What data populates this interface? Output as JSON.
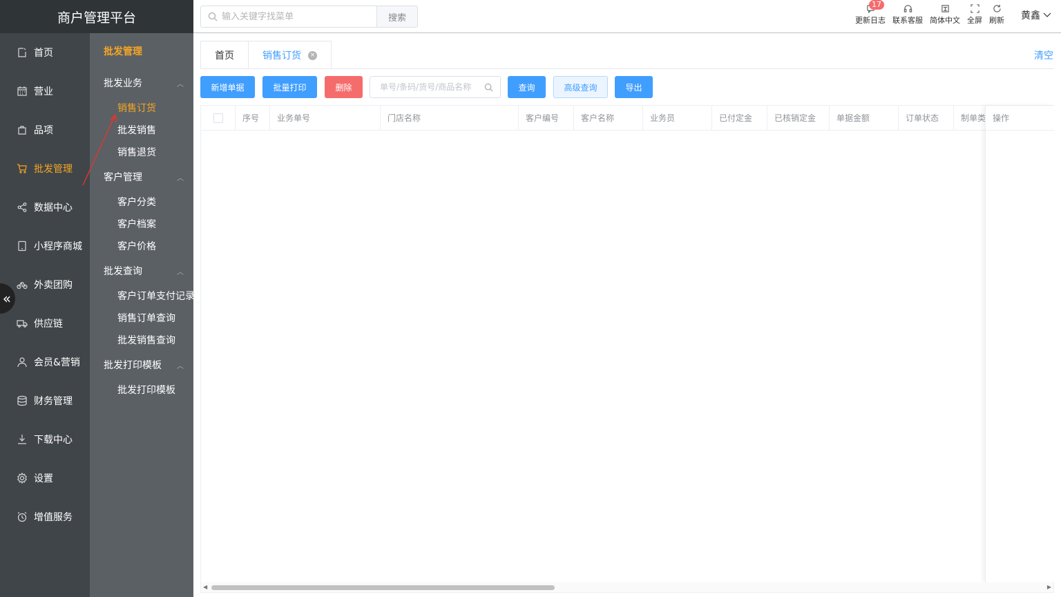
{
  "app": {
    "title": "商户管理平台"
  },
  "primary_nav": [
    {
      "label": "首页",
      "icon": "home-icon",
      "active": false
    },
    {
      "label": "营业",
      "icon": "calendar-icon",
      "active": false
    },
    {
      "label": "品项",
      "icon": "bag-icon",
      "active": false
    },
    {
      "label": "批发管理",
      "icon": "cart-icon",
      "active": true
    },
    {
      "label": "数据中心",
      "icon": "share-icon",
      "active": false
    },
    {
      "label": "小程序商城",
      "icon": "tablet-icon",
      "active": false
    },
    {
      "label": "外卖团购",
      "icon": "bike-icon",
      "active": false
    },
    {
      "label": "供应链",
      "icon": "truck-icon",
      "active": false
    },
    {
      "label": "会员&营销",
      "icon": "user-icon",
      "active": false
    },
    {
      "label": "财务管理",
      "icon": "database-icon",
      "active": false
    },
    {
      "label": "下载中心",
      "icon": "download-icon",
      "active": false
    },
    {
      "label": "设置",
      "icon": "gear-icon",
      "active": false
    },
    {
      "label": "增值服务",
      "icon": "clock-icon",
      "active": false
    }
  ],
  "secondary_nav": {
    "title": "批发管理",
    "groups": [
      {
        "label": "批发业务",
        "items": [
          "销售订货",
          "批发销售",
          "销售退货"
        ]
      },
      {
        "label": "客户管理",
        "items": [
          "客户分类",
          "客户档案",
          "客户价格"
        ]
      },
      {
        "label": "批发查询",
        "items": [
          "客户订单支付记录",
          "销售订单查询",
          "批发销售查询"
        ]
      },
      {
        "label": "批发打印模板",
        "items": [
          "批发打印模板"
        ]
      }
    ],
    "active_item": "销售订货"
  },
  "header": {
    "search_placeholder": "输入关键字找菜单",
    "search_button": "搜索",
    "tools": {
      "changelog": "更新日志",
      "support": "联系客服",
      "language": "简体中文",
      "fullscreen": "全屏",
      "refresh": "刷新"
    },
    "badge_count": "17",
    "user_name": "黄鑫"
  },
  "tabs": [
    {
      "label": "首页",
      "active": false
    },
    {
      "label": "销售订货",
      "active": true,
      "close": "×"
    }
  ],
  "clear_label": "清空",
  "toolbar": {
    "new_doc": "新增单据",
    "batch_print": "批量打印",
    "delete": "删除",
    "filter_placeholder": "单号/条码/货号/商品名称",
    "query": "查询",
    "advanced_query": "高级查询",
    "export": "导出"
  },
  "table": {
    "columns": [
      "序号",
      "业务单号",
      "门店名称",
      "客户编号",
      "客户名称",
      "业务员",
      "已付定金",
      "已核销定金",
      "单据金额",
      "订单状态",
      "制单类型"
    ],
    "fixed_column": "操作",
    "rows": []
  },
  "colors": {
    "accent": "#409eff",
    "active_nav": "#f5a623",
    "danger": "#f56c6c",
    "sidebar_dark": "#404549",
    "sidebar_sub": "#5b6065"
  }
}
